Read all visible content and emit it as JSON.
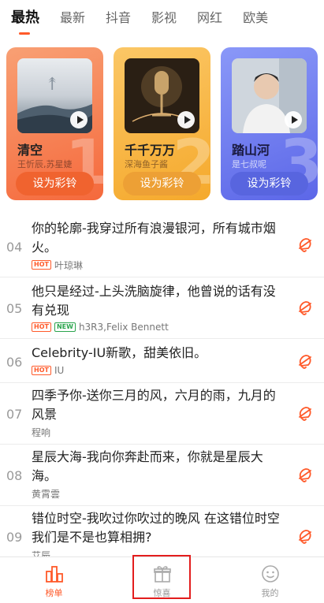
{
  "tabs": [
    {
      "label": "最热",
      "active": true
    },
    {
      "label": "最新",
      "active": false
    },
    {
      "label": "抖音",
      "active": false
    },
    {
      "label": "影视",
      "active": false
    },
    {
      "label": "网红",
      "active": false
    },
    {
      "label": "欧美",
      "active": false
    }
  ],
  "top_cards": [
    {
      "rank": "1",
      "title": "清空",
      "artist": "王忻辰,苏星婕",
      "button": "设为彩铃",
      "theme": "#f5693c"
    },
    {
      "rank": "2",
      "title": "千千万万",
      "artist": "深海鱼子酱",
      "button": "设为彩铃",
      "theme": "#f5a92c"
    },
    {
      "rank": "3",
      "title": "踏山河",
      "artist": "是七叔呢",
      "button": "设为彩铃",
      "theme": "#5c67e8"
    }
  ],
  "songs": [
    {
      "num": "04",
      "title": "你的轮廓-我穿过所有浪漫银河，所有城市烟火。",
      "badges": [
        "HOT"
      ],
      "artist": "叶琼琳"
    },
    {
      "num": "05",
      "title": "他只是经过-上头洗脑旋律，他曾说的话有没有兑现",
      "badges": [
        "HOT",
        "NEW"
      ],
      "artist": "h3R3,Felix Bennett"
    },
    {
      "num": "06",
      "title": "Celebrity-IU新歌，甜美依旧。",
      "badges": [
        "HOT"
      ],
      "artist": "IU"
    },
    {
      "num": "07",
      "title": "四季予你-送你三月的风，六月的雨，九月的风景",
      "badges": [],
      "artist": "程响"
    },
    {
      "num": "08",
      "title": "星辰大海-我向你奔赴而来，你就是星辰大海。",
      "badges": [],
      "artist": "黄霄雲"
    },
    {
      "num": "09",
      "title": "错位时空-我吹过你吹过的晚风 在这错位时空我们是不是也算相拥?",
      "badges": [],
      "artist": "艾辰"
    }
  ],
  "bottom_nav": [
    {
      "label": "榜单",
      "icon": "chart-icon",
      "active": true
    },
    {
      "label": "惊喜",
      "icon": "gift-icon",
      "active": false
    },
    {
      "label": "我的",
      "icon": "smile-face-icon",
      "active": false
    }
  ],
  "colors": {
    "accent": "#ff5a2a",
    "highlight_border": "#e31d1d"
  }
}
